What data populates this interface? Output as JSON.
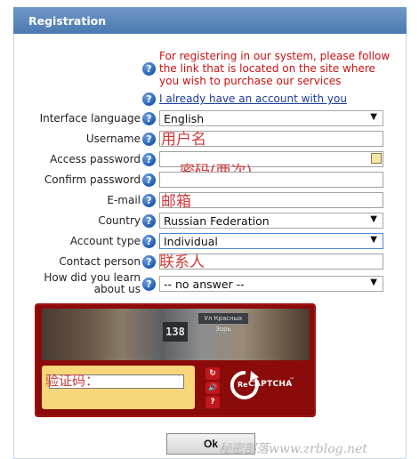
{
  "header": {
    "title": "Registration"
  },
  "notice": {
    "text": "For registering in our system, please follow the link that is located on the site where you wish to purchase our services"
  },
  "login_link": "I already have an account with you",
  "help_glyph": "?",
  "fields": {
    "interface_language": {
      "label": "Interface language",
      "value": "English"
    },
    "username": {
      "label": "Username",
      "annotation": "用户名"
    },
    "access_password": {
      "label": "Access password",
      "annotation": "密码(两次)"
    },
    "confirm_password": {
      "label": "Confirm password"
    },
    "email": {
      "label": "E-mail",
      "annotation": "邮箱"
    },
    "country": {
      "label": "Country",
      "value": "Russian Federation"
    },
    "account_type": {
      "label": "Account type",
      "value": "Individual"
    },
    "contact_person": {
      "label": "Contact person",
      "annotation": "联系人"
    },
    "how_did_you_learn": {
      "label_line1": "How did you learn",
      "label_line2": "about us",
      "value": "-- no answer --"
    }
  },
  "captcha": {
    "image_number": "138",
    "image_sign": "Ул Красных Зорь",
    "prompt": "验证码：",
    "logo_text_re": "Re",
    "logo_text": "CAPTCHA",
    "logo_tm": "™",
    "refresh_icon": "↻",
    "audio_icon": "🔊",
    "help_icon": "?"
  },
  "ok_label": "Ok",
  "watermark": "秘密部落www.zrblog.net",
  "colors": {
    "header": "#4a79b0",
    "notice": "#cc1111",
    "annotation": "#d23a3a",
    "captcha": "#8b0b0b"
  }
}
